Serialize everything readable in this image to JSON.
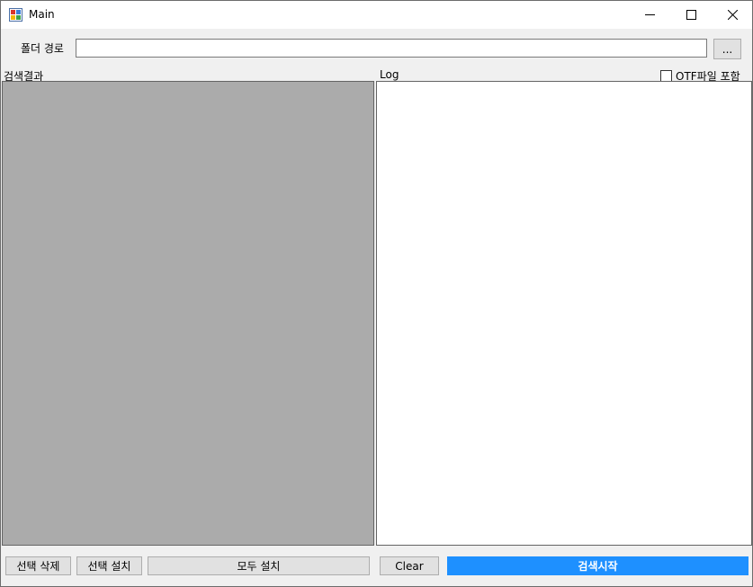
{
  "window": {
    "title": "Main"
  },
  "titlebar": {
    "minimize_icon": "minimize-icon",
    "maximize_icon": "maximize-icon",
    "close_icon": "close-icon"
  },
  "folder": {
    "label": "폴더 경로",
    "value": "",
    "browse_label": "..."
  },
  "results": {
    "label": "검색결과"
  },
  "log": {
    "label": "Log",
    "otf_label": "OTF파일 포함",
    "otf_checked": false
  },
  "footer": {
    "delete_selected": "선택 삭제",
    "install_selected": "선택 설치",
    "install_all": "모두 설치",
    "clear": "Clear",
    "start_search": "검색시작"
  },
  "colors": {
    "primary": "#1e90ff",
    "results_bg": "#ababab",
    "window_bg": "#f0f0f0"
  }
}
